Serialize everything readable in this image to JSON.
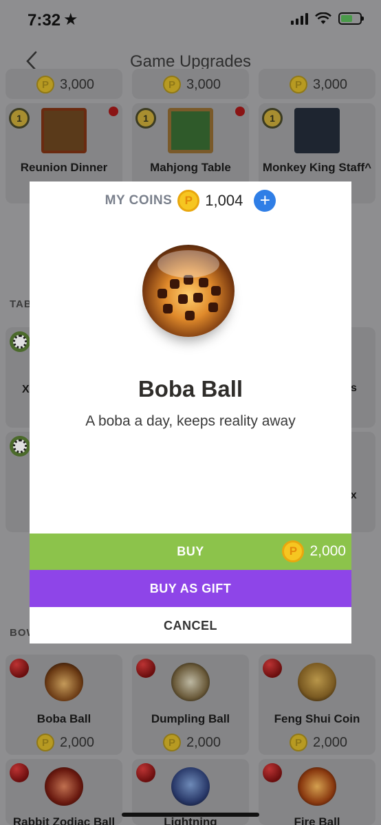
{
  "status_bar": {
    "time": "7:32",
    "star": "★"
  },
  "nav": {
    "title": "Game Upgrades"
  },
  "top_prices": [
    "3,000",
    "3,000",
    "3,000"
  ],
  "upgrade_items": [
    {
      "name": "Reunion Dinner",
      "level": "1"
    },
    {
      "name": "Mahjong Table",
      "level": "1"
    },
    {
      "name": "Monkey King Staff^",
      "level": "1"
    }
  ],
  "sections": {
    "tables_label": "TAB",
    "bowling_label": "BOW"
  },
  "partial_texts": {
    "left_x": "X",
    "right_s": "s",
    "right_ox": "ox"
  },
  "bowling_items": [
    {
      "name": "Boba Ball",
      "price": "2,000"
    },
    {
      "name": "Dumpling Ball",
      "price": "2,000"
    },
    {
      "name": "Feng Shui Coin",
      "price": "2,000"
    },
    {
      "name": "Rabbit Zodiac Ball",
      "price": ""
    },
    {
      "name": "Lightning",
      "price": ""
    },
    {
      "name": "Fire Ball",
      "price": ""
    }
  ],
  "coin_symbol": "P",
  "modal": {
    "coins_label": "MY COINS",
    "coins_value": "1,004",
    "plus": "+",
    "item_title": "Boba Ball",
    "item_description": "A boba a day, keeps reality away",
    "buy_label": "BUY",
    "buy_price": "2,000",
    "gift_label": "BUY AS GIFT",
    "cancel_label": "CANCEL"
  },
  "colors": {
    "buy": "#8cc34b",
    "gift": "#8e45e8",
    "plus": "#2f7ee6",
    "coin": "#f6c621"
  },
  "icons": [
    "back-chevron-icon",
    "coin-icon",
    "plus-icon",
    "level-badge-icon",
    "notification-dot-icon",
    "soccer-ball-icon",
    "bowling-ball-icon"
  ]
}
